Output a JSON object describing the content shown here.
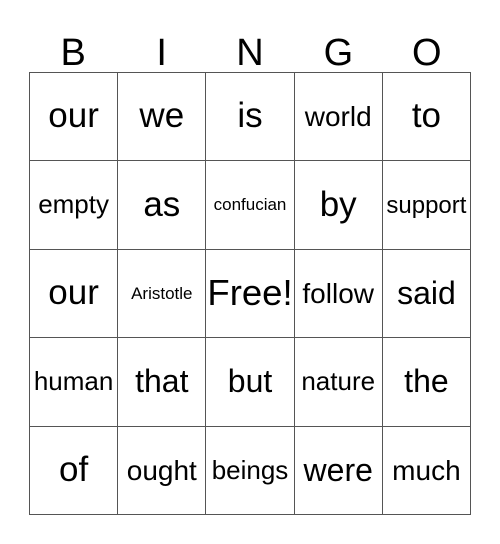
{
  "header": {
    "letters": [
      "B",
      "I",
      "N",
      "G",
      "O"
    ]
  },
  "colors": {
    "grid_line": "#555555",
    "text": "#000000",
    "background": "#ffffff"
  },
  "grid": {
    "rows": 5,
    "columns": 5,
    "free_space": "Free!",
    "cells": [
      [
        {
          "text": "our",
          "size": "fs-xl"
        },
        {
          "text": "we",
          "size": "fs-xl"
        },
        {
          "text": "is",
          "size": "fs-xl"
        },
        {
          "text": "world",
          "size": "fs-m"
        },
        {
          "text": "to",
          "size": "fs-xl"
        }
      ],
      [
        {
          "text": "empty",
          "size": "fs-s"
        },
        {
          "text": "as",
          "size": "fs-xl"
        },
        {
          "text": "confucian",
          "size": "fs-xxs"
        },
        {
          "text": "by",
          "size": "fs-xl"
        },
        {
          "text": "support",
          "size": "fs-xs"
        }
      ],
      [
        {
          "text": "our",
          "size": "fs-xl"
        },
        {
          "text": "Aristotle",
          "size": "fs-xxs"
        },
        {
          "text": "Free!",
          "size": "fs-xxl"
        },
        {
          "text": "follow",
          "size": "fs-m"
        },
        {
          "text": "said",
          "size": "fs-l"
        }
      ],
      [
        {
          "text": "human",
          "size": "fs-s"
        },
        {
          "text": "that",
          "size": "fs-l"
        },
        {
          "text": "but",
          "size": "fs-l"
        },
        {
          "text": "nature",
          "size": "fs-s"
        },
        {
          "text": "the",
          "size": "fs-l"
        }
      ],
      [
        {
          "text": "of",
          "size": "fs-xl"
        },
        {
          "text": "ought",
          "size": "fs-m"
        },
        {
          "text": "beings",
          "size": "fs-s"
        },
        {
          "text": "were",
          "size": "fs-l"
        },
        {
          "text": "much",
          "size": "fs-m"
        }
      ]
    ]
  }
}
